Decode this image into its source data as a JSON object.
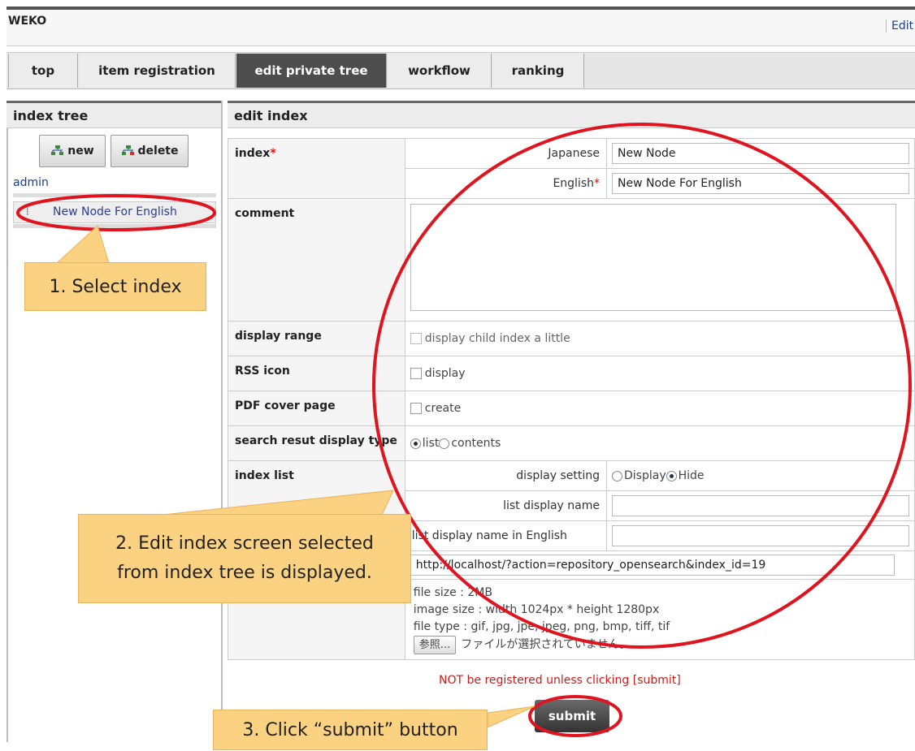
{
  "app": {
    "title": "WEKO",
    "edit_link": "Edit"
  },
  "tabs": [
    {
      "label": "top"
    },
    {
      "label": "item registration"
    },
    {
      "label": "edit private tree",
      "active": true
    },
    {
      "label": "workflow"
    },
    {
      "label": "ranking"
    }
  ],
  "index_tree": {
    "heading": "index tree",
    "new_label": "new",
    "delete_label": "delete",
    "root": "admin",
    "node": "New Node For English"
  },
  "edit_index": {
    "heading": "edit index",
    "index_label": "index",
    "required_mark": "*",
    "japanese_label": "Japanese",
    "japanese_value": "New Node",
    "english_label": "English",
    "english_value": "New Node For English",
    "comment_label": "comment",
    "display_range_label": "display range",
    "display_range_option": "display child index a little",
    "rss_label": "RSS icon",
    "rss_option": "display",
    "pdf_label": "PDF cover page",
    "pdf_option": "create",
    "search_type_label": "search resut display type",
    "search_type_list": "list",
    "search_type_contents": "contents",
    "index_list_label": "index list",
    "display_setting_label": "display setting",
    "display_option": "Display",
    "hide_option": "Hide",
    "list_display_name_label": "list display name",
    "list_display_name_en_label": "list display name in English",
    "opensearch_url": "http://localhost/?action=repository_opensearch&index_id=19",
    "file_size": "file size : 2MB",
    "image_size": "image size : width 1024px * height 1280px",
    "file_type": "file type : gif, jpg, jpe, jpeg, png, bmp, tiff, tif",
    "browse_label": "参照...",
    "no_file": "ファイルが選択されていません。"
  },
  "notice": "NOT be registered unless clicking [submit]",
  "submit_label": "submit",
  "callouts": {
    "step1": "1. Select index",
    "step2_line1": "2. Edit index screen  selected",
    "step2_line2": "from index tree is displayed.",
    "step3": "3. Click “submit” button"
  },
  "colors": {
    "highlight": "#e0141e",
    "callout": "#fbd282",
    "active_tab": "#4d4d4d"
  }
}
